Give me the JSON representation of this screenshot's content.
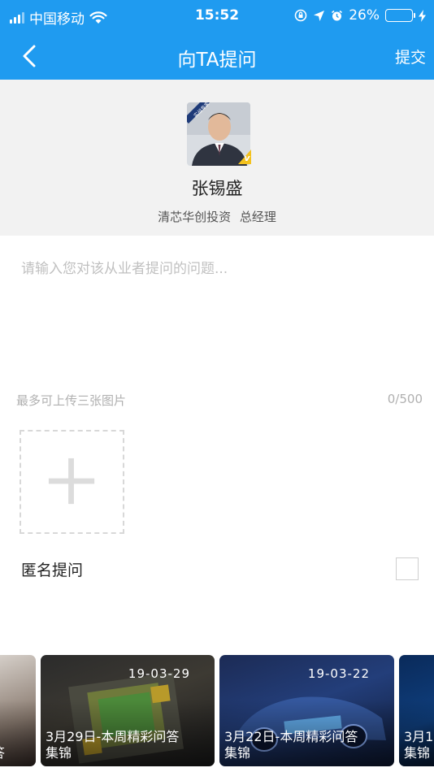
{
  "status_bar": {
    "carrier": "中国移动",
    "time": "15:52",
    "battery_percent": "26%",
    "battery_level": 0.26,
    "icons": [
      "signal-icon",
      "wifi-icon",
      "orientation-lock-icon",
      "location-icon",
      "alarm-icon",
      "battery-icon",
      "charging-icon"
    ]
  },
  "nav": {
    "back_icon": "chevron-left-icon",
    "title": "向TA提问",
    "submit_label": "提交"
  },
  "profile": {
    "badge_text": "实战专家",
    "verify_mark": "v",
    "name": "张锡盛",
    "title": "清芯华创投资 总经理"
  },
  "question": {
    "placeholder": "请输入您对该从业者提问的问题...",
    "value": ""
  },
  "upload": {
    "hint": "最多可上传三张图片",
    "char_count": "0/500",
    "add_icon": "plus-icon"
  },
  "anonymous": {
    "label": "匿名提问",
    "checked": false
  },
  "cards": [
    {
      "date": "",
      "caption_line1": "答",
      "caption_line2": ""
    },
    {
      "date": "19-03-29",
      "caption_line1": "3月29日-本周精彩问答",
      "caption_line2": "集锦"
    },
    {
      "date": "19-03-22",
      "caption_line1": "3月22日-本周精彩问答",
      "caption_line2": "集锦"
    },
    {
      "date": "",
      "caption_line1": "3月1",
      "caption_line2": "集锦"
    }
  ],
  "colors": {
    "accent": "#1f9bf0",
    "profile_background": "#f2f2f2",
    "verify_badge": "#f4c21e",
    "battery_fill": "#4cd964"
  }
}
